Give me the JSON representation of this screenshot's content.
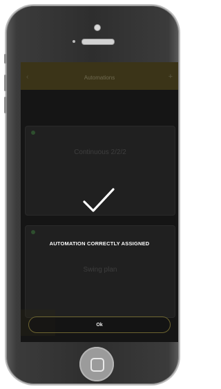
{
  "app": {
    "status_time": "",
    "header_title": "Automations",
    "back_icon": "chevron-left-icon",
    "add_icon": "plus-icon"
  },
  "stats": {
    "heading": "",
    "left_value": "",
    "left_label": "",
    "right_value": "",
    "right_label": ""
  },
  "cards": [
    {
      "status": "",
      "link": "",
      "title": "Continuous 2/2/2",
      "left_label": "",
      "left_value": "",
      "right_label": "",
      "right_value": ""
    },
    {
      "status": "",
      "link": "",
      "title": "Swing plan",
      "left_label": "",
      "left_value": "",
      "right_label": "",
      "right_value": ""
    }
  ],
  "overlay": {
    "icon": "checkmark-icon",
    "message": "AUTOMATION CORRECTLY ASSIGNED",
    "ok_label": "Ok"
  },
  "colors": {
    "accent": "#6d6430",
    "background": "#151515",
    "header": "#3b3418"
  }
}
